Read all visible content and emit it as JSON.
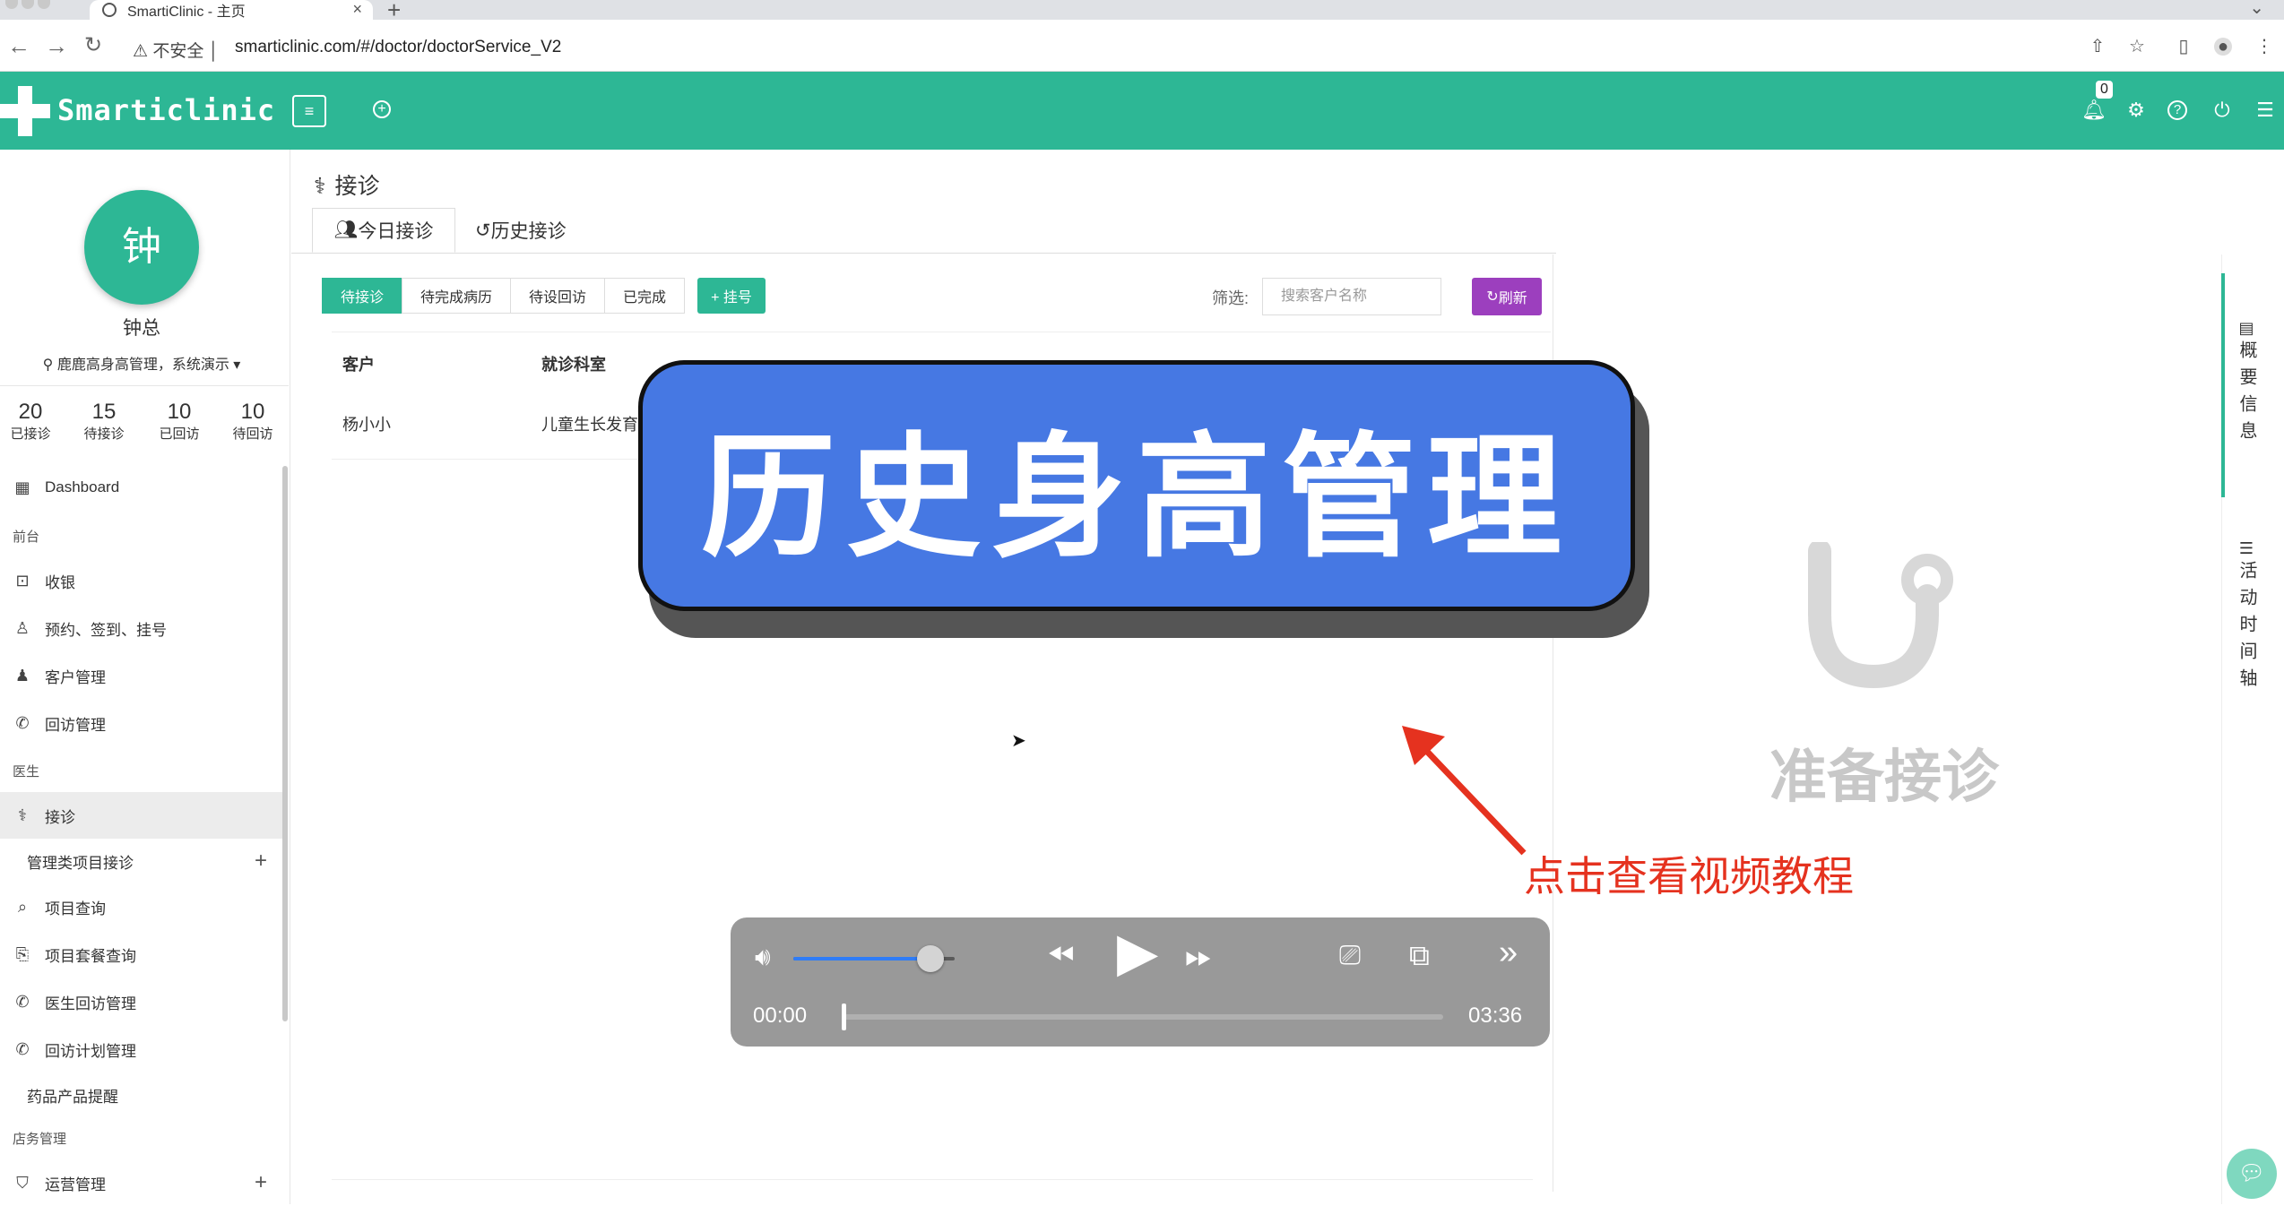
{
  "browser": {
    "tab_title": "SmartiClinic - 主页",
    "security_label": "不安全",
    "url": "smarticlinic.com/#/doctor/doctorService_V2",
    "new_tab": "+",
    "close_tab": "×"
  },
  "header": {
    "logo_text": "Smarticlinic",
    "notification_count": "0",
    "accent_color": "#2db795"
  },
  "user": {
    "avatar_char": "钟",
    "name": "钟总",
    "org": "鹿鹿高身高管理，系统演示 ▾"
  },
  "stats": [
    {
      "value": "20",
      "label": "已接诊"
    },
    {
      "value": "15",
      "label": "待接诊"
    },
    {
      "value": "10",
      "label": "已回访"
    },
    {
      "value": "10",
      "label": "待回访"
    }
  ],
  "sidebar": {
    "dashboard": "Dashboard",
    "group_front": "前台",
    "cashier": "收银",
    "appointment": "预约、签到、挂号",
    "customer": "客户管理",
    "followup": "回访管理",
    "group_doctor": "医生",
    "consult": "接诊",
    "mgmt_consult": "管理类项目接诊",
    "item_query": "项目查询",
    "package_query": "项目套餐查询",
    "doctor_followup": "医生回访管理",
    "followup_plan": "回访计划管理",
    "drug_reminder": "药品产品提醒",
    "group_store": "店务管理",
    "operations": "运营管理"
  },
  "page": {
    "title": "接诊",
    "tab_today": "今日接诊",
    "tab_history": "历史接诊",
    "subtabs": [
      "待接诊",
      "待完成病历",
      "待设回访",
      "已完成"
    ],
    "register_btn": "+ 挂号",
    "filter_label": "筛选:",
    "search_placeholder": "搜索客户名称",
    "refresh_btn": "刷新",
    "columns": [
      "客户",
      "就诊科室"
    ],
    "row": {
      "customer": "杨小小",
      "department": "儿童生长发育"
    }
  },
  "right_panel": {
    "ready_text": "准备接诊",
    "tab_overview": "概要信息",
    "tab_timeline": "活动时间轴"
  },
  "overlay": {
    "banner_text": "历史身高管理",
    "banner_color": "#4678e3",
    "cta_text": "点击查看视频教程",
    "cta_color": "#e5321f"
  },
  "player": {
    "time_current": "00:00",
    "time_total": "03:36",
    "volume": 0.85,
    "progress": 0
  }
}
